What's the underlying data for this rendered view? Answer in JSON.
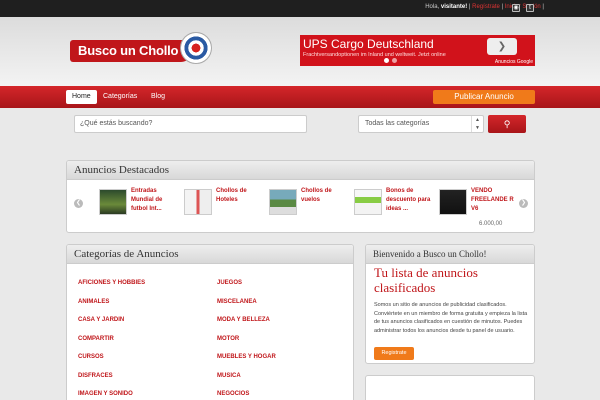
{
  "topbar": {
    "greeting": "Hola,",
    "user": "visitante!",
    "register": "Regístrate",
    "login": "Iniciar Sesión",
    "rss_icon": "rss-icon",
    "twitter_icon": "twitter-icon"
  },
  "logo": {
    "text": "Busco un Chollo"
  },
  "ad": {
    "title": "UPS Cargo Deutschland",
    "subtitle": "Frachtversandoptionen im Inland und weltweit. Jetzt online",
    "by": "Anuncios Google"
  },
  "nav": {
    "items": [
      "Home",
      "Categorías",
      "Blog"
    ],
    "active": "Home",
    "publish": "Publicar Anuncio"
  },
  "search": {
    "placeholder": "¿Qué estás buscando?",
    "category": "Todas las categorías"
  },
  "featured": {
    "title": "Anuncios Destacados",
    "items": [
      {
        "caption": "Entradas Mundial de futbol Int...",
        "price": ""
      },
      {
        "caption": "Chollos de Hoteles",
        "price": ""
      },
      {
        "caption": "Chollos de vuelos",
        "price": ""
      },
      {
        "caption": "Bonos de descuento para ideas ...",
        "price": ""
      },
      {
        "caption": "VENDO FREELANDE R V6",
        "price": "6.000,00"
      }
    ]
  },
  "categories": {
    "title": "Categorías de Anuncios",
    "left": [
      "AFICIONES Y HOBBIES",
      "ANIMALES",
      "CASA Y JARDIN",
      "COMPARTIR",
      "CURSOS",
      "DISFRACES",
      "IMAGEN Y SONIDO"
    ],
    "right": [
      "JUEGOS",
      "MISCELANEA",
      "MODA Y BELLEZA",
      "MOTOR",
      "MUEBLES Y HOGAR",
      "MUSICA",
      "NEGOCIOS"
    ]
  },
  "welcome": {
    "title": "Bienvenido a Busco un Chollo!",
    "heading": "Tu lista de anuncios clasificados",
    "description": "Somos un sitio de anuncios de publicidad clasificados. Conviértete en un miembro de forma gratuita y empieza la lista de tus anuncios clasificados en cuestión de minutos. Puedes administrar todos los anuncios desde tu panel de usuario.",
    "button": "Registrate"
  }
}
